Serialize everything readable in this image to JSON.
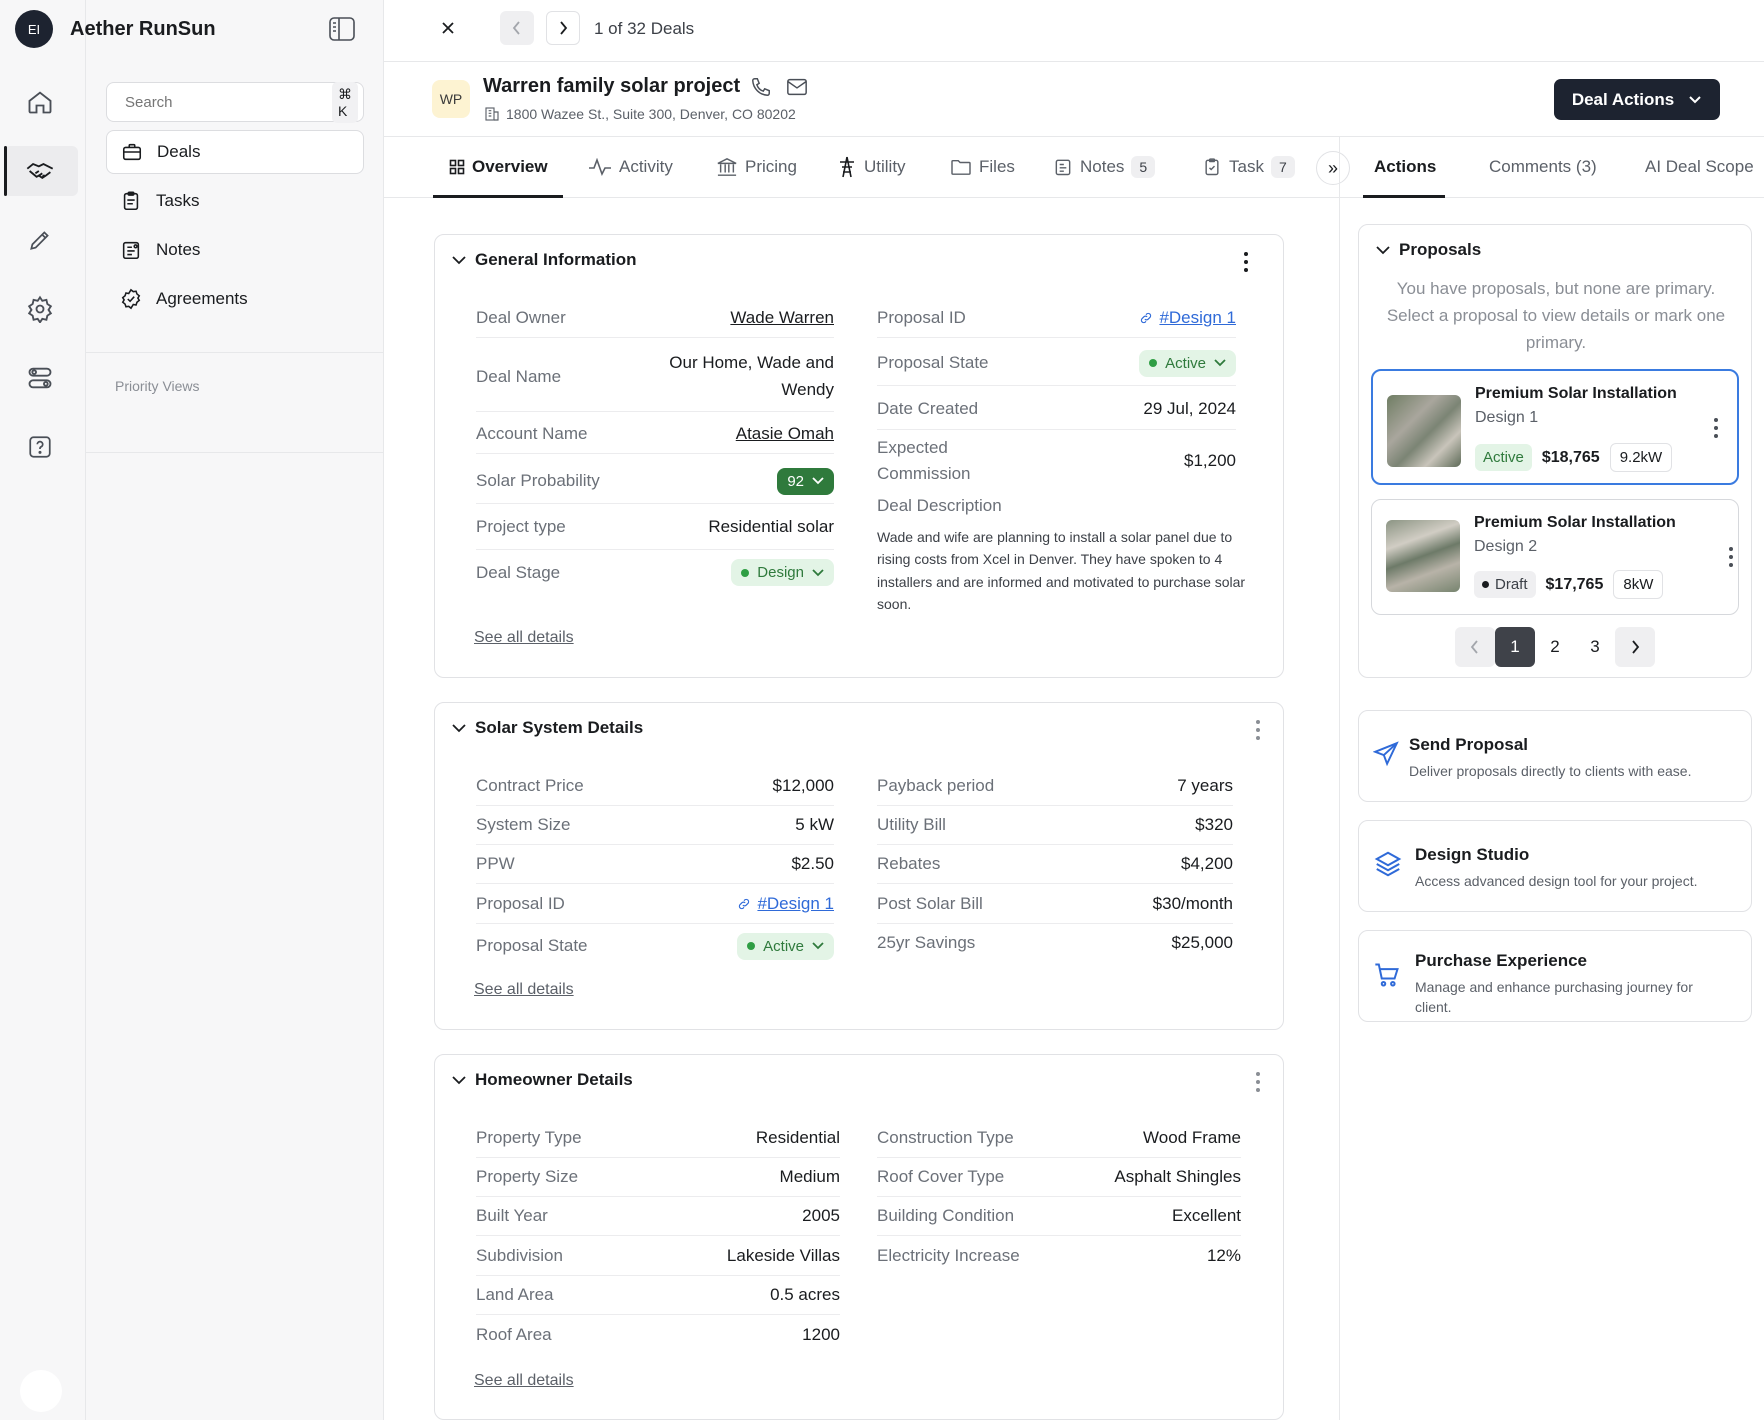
{
  "app": {
    "initials": "EI",
    "name": "Aether RunSun"
  },
  "sidebar": {
    "search_placeholder": "Search",
    "search_shortcut": "⌘ K",
    "items": [
      {
        "label": "Deals",
        "icon": "briefcase-icon"
      },
      {
        "label": "Tasks",
        "icon": "clipboard-icon"
      },
      {
        "label": "Notes",
        "icon": "note-icon"
      },
      {
        "label": "Agreements",
        "icon": "badge-check-icon"
      }
    ],
    "section_label": "Priority Views"
  },
  "rail": {
    "icons": [
      "home-icon",
      "handshake-icon",
      "pencil-icon",
      "gear-icon",
      "toggles-icon",
      "help-icon"
    ]
  },
  "topbar": {
    "counter": "1 of 32 Deals"
  },
  "deal": {
    "initials": "WP",
    "title": "Warren family solar project",
    "address": "1800 Wazee St., Suite 300, Denver, CO 80202",
    "actions_label": "Deal Actions"
  },
  "tabs": [
    {
      "label": "Overview"
    },
    {
      "label": "Activity"
    },
    {
      "label": "Pricing"
    },
    {
      "label": "Utility"
    },
    {
      "label": "Files"
    },
    {
      "label": "Notes",
      "count": "5"
    },
    {
      "label": "Task",
      "count": "7"
    }
  ],
  "more_tabs": "»",
  "right_tabs": [
    "Actions",
    "Comments (3)",
    "AI Deal Scope"
  ],
  "general": {
    "title": "General Information",
    "left": [
      {
        "k": "Deal Owner",
        "v": "Wade Warren"
      },
      {
        "k": "Deal Name",
        "v": "Our Home, Wade and Wendy"
      },
      {
        "k": "Account Name",
        "v": "Atasie Omah"
      },
      {
        "k": "Solar Probability",
        "v": "92"
      },
      {
        "k": "Project type",
        "v": "Residential solar"
      },
      {
        "k": "Deal Stage",
        "v": "Design"
      }
    ],
    "right": [
      {
        "k": "Proposal ID",
        "v": "#Design 1"
      },
      {
        "k": "Proposal State",
        "v": "Active"
      },
      {
        "k": "Date Created",
        "v": "29 Jul, 2024"
      },
      {
        "k": "Expected Commission",
        "v": "$1,200"
      }
    ],
    "description_label": "Deal Description",
    "description": "Wade and wife are planning to install a solar panel due to rising costs from Xcel in Denver. They have spoken to 4 installers and are informed and motivated to purchase solar soon.",
    "see_all": "See all details"
  },
  "solar": {
    "title": "Solar System Details",
    "left": [
      {
        "k": "Contract Price",
        "v": "$12,000"
      },
      {
        "k": "System Size",
        "v": "5 kW"
      },
      {
        "k": "PPW",
        "v": "$2.50"
      },
      {
        "k": "Proposal ID",
        "v": "#Design 1"
      },
      {
        "k": "Proposal State",
        "v": "Active"
      }
    ],
    "right": [
      {
        "k": "Payback period",
        "v": "7 years"
      },
      {
        "k": "Utility Bill",
        "v": "$320"
      },
      {
        "k": "Rebates",
        "v": "$4,200"
      },
      {
        "k": "Post Solar Bill",
        "v": "$30/month"
      },
      {
        "k": "25yr Savings",
        "v": "$25,000"
      }
    ],
    "see_all": "See all details"
  },
  "homeowner": {
    "title": "Homeowner Details",
    "left": [
      {
        "k": "Property Type",
        "v": "Residential"
      },
      {
        "k": "Property Size",
        "v": "Medium"
      },
      {
        "k": "Built Year",
        "v": "2005"
      },
      {
        "k": "Subdivision",
        "v": "Lakeside Villas"
      },
      {
        "k": "Land Area",
        "v": "0.5 acres"
      },
      {
        "k": "Roof Area",
        "v": "1200"
      }
    ],
    "right": [
      {
        "k": "Construction Type",
        "v": "Wood Frame"
      },
      {
        "k": "Roof Cover Type",
        "v": "Asphalt Shingles"
      },
      {
        "k": "Building Condition",
        "v": "Excellent"
      },
      {
        "k": "Electricity Increase",
        "v": "12%"
      }
    ],
    "see_all": "See all details"
  },
  "proposals": {
    "title": "Proposals",
    "hint": "You have proposals, but none are primary. Select a proposal to view details or mark one primary.",
    "items": [
      {
        "title": "Premium Solar Installation",
        "design": "Design 1",
        "status": "Active",
        "price": "$18,765",
        "size": "9.2kW"
      },
      {
        "title": "Premium Solar Installation",
        "design": "Design 2",
        "status": "Draft",
        "price": "$17,765",
        "size": "8kW"
      }
    ],
    "pages": [
      "1",
      "2",
      "3"
    ]
  },
  "actions": [
    {
      "title": "Send Proposal",
      "desc": "Deliver proposals directly to clients with ease.",
      "icon": "send-icon"
    },
    {
      "title": "Design Studio",
      "desc": "Access advanced design tool for your project.",
      "icon": "layers-icon"
    },
    {
      "title": "Purchase Experience",
      "desc": "Manage and enhance purchasing journey for client.",
      "icon": "cart-icon"
    }
  ],
  "colors": {
    "primary_dark": "#1d2330",
    "active_green": "#2f7a3c",
    "link_blue": "#2f6ad8",
    "selected_border": "#3a7be0"
  }
}
